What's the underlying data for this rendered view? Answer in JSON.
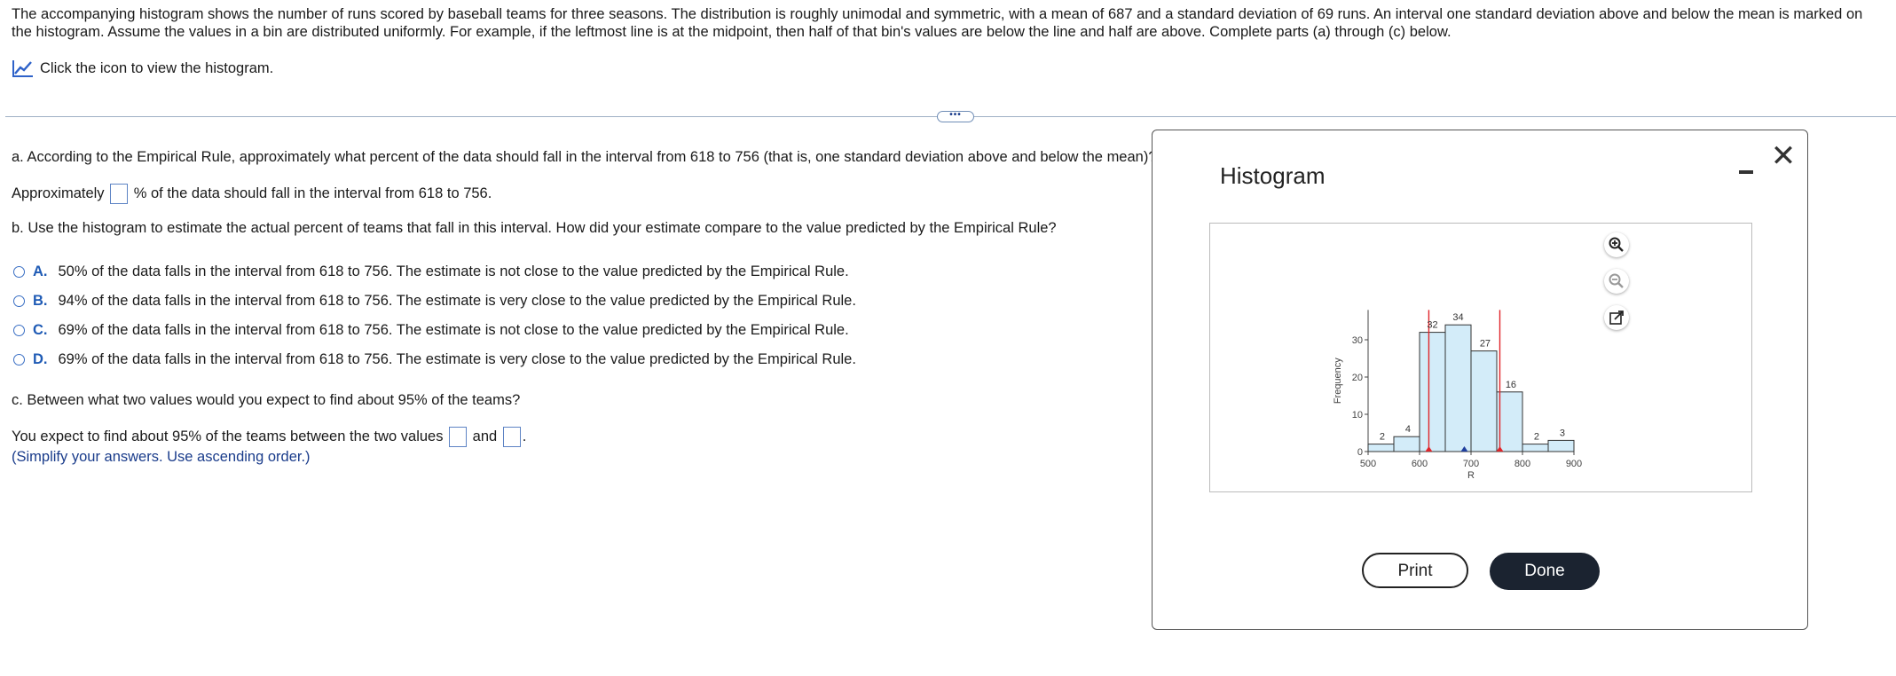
{
  "intro": "The accompanying histogram shows the number of runs scored by baseball teams for three seasons. The distribution is roughly unimodal and symmetric, with a mean of 687 and a standard deviation of 69 runs. An interval one standard deviation above and below the mean is marked on the histogram. Assume the values in a bin are distributed uniformly. For example, if the leftmost line is at the midpoint, then half of that bin's values are below the line and half are above. Complete parts (a) through (c) below.",
  "icon_link": "Click the icon to view the histogram.",
  "expander": "•••",
  "qa": {
    "question": "a. According to the Empirical Rule, approximately what percent of the data should fall in the interval from 618 to 756 (that is, one standard deviation above and below the mean)?",
    "pre": "Approximately",
    "post": "% of the data should fall in the interval from 618 to 756."
  },
  "qb": {
    "question": "b. Use the histogram to estimate the actual percent of teams that fall in this interval. How did your estimate compare to the value predicted by the Empirical Rule?",
    "choices": [
      {
        "letter": "A.",
        "text": "50% of the data falls in the interval from 618 to 756. The estimate is not close to the value predicted by the Empirical Rule."
      },
      {
        "letter": "B.",
        "text": "94% of the data falls in the interval from 618 to 756. The estimate is very close to the value predicted by the Empirical Rule."
      },
      {
        "letter": "C.",
        "text": "69% of the data falls in the interval from 618 to 756. The estimate is not close to the value predicted by the Empirical Rule."
      },
      {
        "letter": "D.",
        "text": "69% of the data falls in the interval from 618 to 756. The estimate is very close to the value predicted by the Empirical Rule."
      }
    ]
  },
  "qc": {
    "question": "c. Between what two values would you expect to find about 95% of the teams?",
    "pre": "You expect to find about 95% of the teams between the two values",
    "and": "and",
    "end": ".",
    "hint": "(Simplify your answers. Use ascending order.)"
  },
  "modal": {
    "title": "Histogram",
    "print_label": "Print",
    "done_label": "Done",
    "close_glyph": "✕"
  },
  "chart_data": {
    "type": "bar",
    "title": "",
    "xlabel": "R",
    "ylabel": "Frequency",
    "bin_edges": [
      500,
      550,
      600,
      650,
      700,
      750,
      800,
      850,
      900
    ],
    "values": [
      2,
      4,
      32,
      34,
      27,
      16,
      2,
      3
    ],
    "xticks": [
      500,
      600,
      700,
      800,
      900
    ],
    "yticks": [
      0,
      10,
      20,
      30
    ],
    "xlim": [
      500,
      900
    ],
    "ylim": [
      0,
      38
    ],
    "marked_lines": [
      618,
      756
    ],
    "mean": 687,
    "bar_color": "#d3ecf9",
    "line_color": "#e0252a",
    "mean_marker_color": "#1f3f9e"
  }
}
